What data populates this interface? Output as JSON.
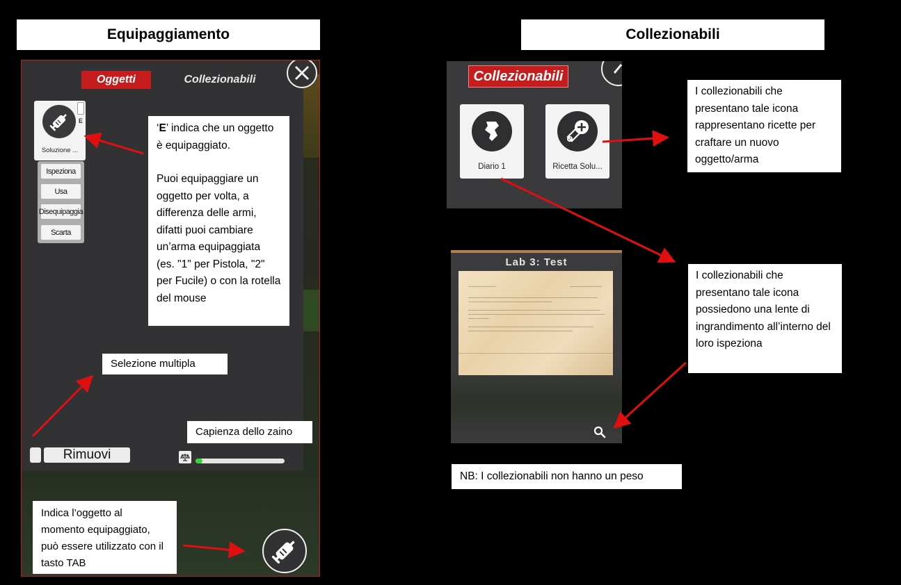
{
  "headers": {
    "left": "Equipaggiamento",
    "right": "Collezionabili"
  },
  "inventory": {
    "tabs": [
      "Oggetti",
      "Collezionabili"
    ],
    "item_label": "Soluzione ...",
    "item_badge": "E",
    "context_menu": [
      "Ispeziona",
      "Usa",
      "Disequipaggia",
      "Scarta"
    ],
    "remove_button": "Rimuovi",
    "capacity_fill": 0.08
  },
  "notes": {
    "equip_intro_prefix": "‘",
    "equip_intro_key": "E",
    "equip_intro_suffix": "’ indica che un oggetto è equipaggiato.",
    "equip_body": "Puoi equipaggiare un oggetto per volta, a differenza delle armi, difatti puoi cambiare un’arma equipaggiata (es. \"1\" per Pistola, \"2\" per Fucile) o con la rotella del mouse",
    "multi_select": "Selezione multipla",
    "backpack_capacity": "Capienza dello zaino",
    "equipped_item": "Indica l’oggetto al momento equipaggiato, può essere utilizzato con il tasto TAB",
    "recipe_icon": "I collezionabili che presentano tale icona rappresentano ricette per craftare un nuovo oggetto/arma",
    "magnifier_icon": "I collezionabili che presentano tale icona possiedono una lente di ingrandimento all’interno del loro ispeziona",
    "no_weight": "NB: I collezionabili non hanno un peso"
  },
  "collectibles": {
    "tab": "Collezionabili",
    "cards": [
      "Diario 1",
      "Ricetta Solu..."
    ]
  },
  "inspect": {
    "title": "Lab 3: Test"
  },
  "colors": {
    "accent_red": "#c51d1d",
    "arrow_red": "#e01010",
    "panel_dark": "#323234",
    "capacity_green": "#38d23a"
  }
}
